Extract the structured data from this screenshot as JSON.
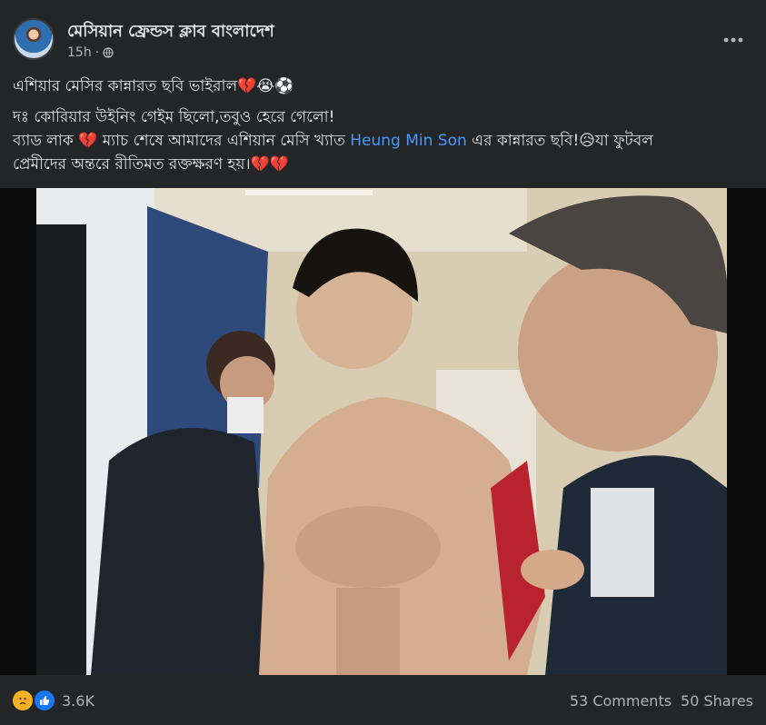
{
  "page": {
    "name": "মেসিয়ান ফ্রেন্ডস ক্লাব বাংলাদেশ",
    "time": "15h",
    "dot": "·"
  },
  "post": {
    "line1": "এশিয়ার মেসির কান্নারত ছবি ভাইরাল💔😭⚽",
    "line2": "দঃ কোরিয়ার উইনিং গেইম ছিলো,তবুও হেরে গেলো!",
    "line3_a": "ব্যাড লাক 💔  ম্যাচ শেষে আমাদের এশিয়ান মেসি খ্যাত ",
    "mention": "Heung Min Son",
    "line3_b": " এর কান্নারত ছবি!😥যা ফুটবল",
    "line4": "প্রেমীদের অন্তরে রীতিমত রক্তক্ষরণ হয়।💔💔"
  },
  "reactions": {
    "count": "3.6K",
    "comments": "53 Comments",
    "shares": "50 Shares"
  },
  "icons": [
    "avatar",
    "globe-icon",
    "more-icon",
    "sad-icon",
    "like-icon"
  ],
  "colors": {
    "background": "#242526",
    "text": "#e4e6eb",
    "secondary": "#b0b3b8",
    "link": "#4599ff"
  }
}
